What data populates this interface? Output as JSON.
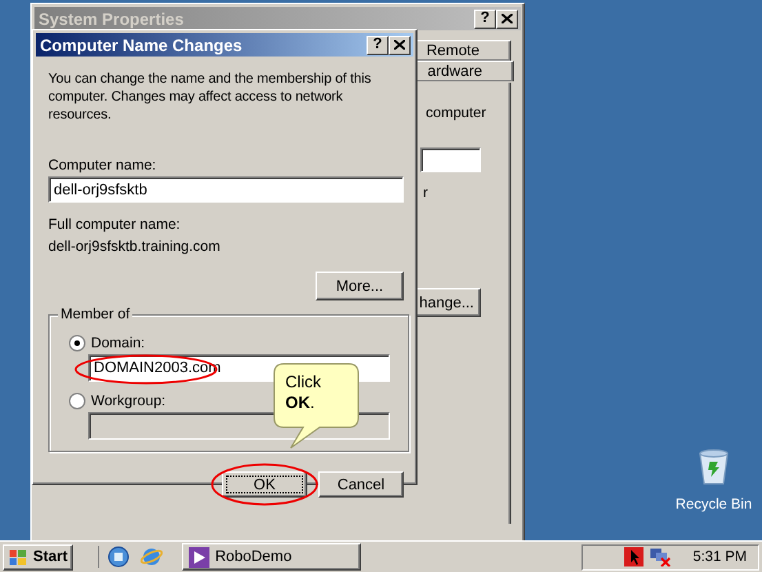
{
  "back_window": {
    "title": "System Properties",
    "help_button": "?",
    "tabs": [
      {
        "label": "Remote"
      },
      {
        "label": "ardware"
      }
    ],
    "text": "computer",
    "partial_label": "r",
    "button": "hange..."
  },
  "dialog": {
    "title": "Computer Name Changes",
    "help_button": "?",
    "intro": "You can change the name and the membership of this computer. Changes may affect access to network resources.",
    "computer_name_label": "Computer name:",
    "computer_name": "dell-orj9sfsktb",
    "full_name_label": "Full computer name:",
    "full_name": "dell-orj9sfsktb.training.com",
    "more_button": "More...",
    "group_label": "Member of",
    "options": [
      {
        "label": "Domain:",
        "selected": true,
        "value": "DOMAIN2003.com",
        "highlighted": true
      },
      {
        "label": "Workgroup:",
        "selected": false,
        "highlighted": false
      }
    ],
    "buttons": [
      {
        "label": "OK",
        "highlighted": true
      },
      {
        "label": "Cancel",
        "highlighted": false
      }
    ]
  },
  "callout": {
    "text": "Click **OK**."
  },
  "desktop_icons": [
    {
      "label": "Recycle Bin"
    }
  ],
  "taskbar": {
    "start": "Start",
    "tasks": [
      {
        "label": "RoboDemo"
      }
    ],
    "clock": "5:31 PM"
  }
}
